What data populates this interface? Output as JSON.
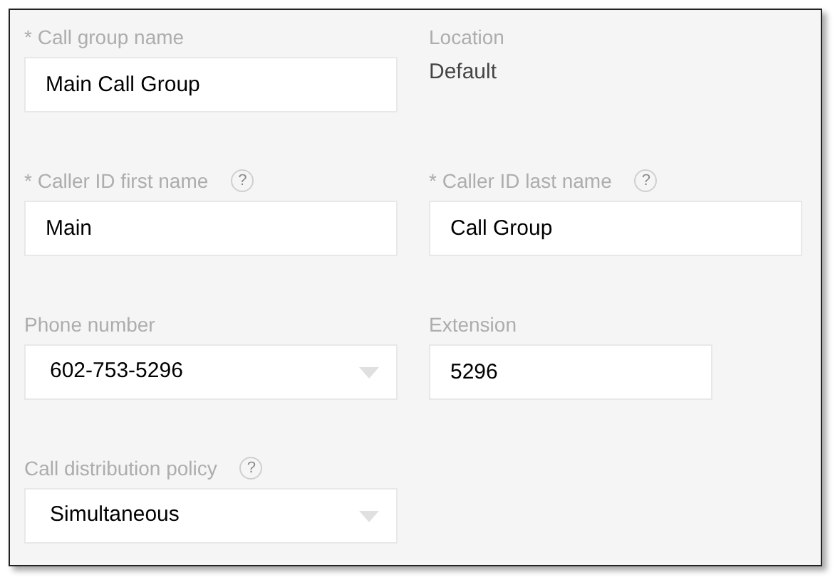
{
  "fields": [
    {
      "kind": "input",
      "label": "* Call group name",
      "value": "Main Call Group",
      "help": false,
      "short": false
    },
    {
      "kind": "static",
      "label": "Location",
      "value": "Default",
      "help": false,
      "short": false
    },
    {
      "kind": "input",
      "label": "* Caller ID first name",
      "value": "Main",
      "help": true,
      "short": false
    },
    {
      "kind": "input",
      "label": "* Caller ID last name",
      "value": "Call Group",
      "help": true,
      "short": false
    },
    {
      "kind": "select",
      "label": "Phone number",
      "value": "602-753-5296",
      "help": false,
      "short": false
    },
    {
      "kind": "input",
      "label": "Extension",
      "value": "5296",
      "help": false,
      "short": true
    },
    {
      "kind": "select",
      "label": "Call distribution policy",
      "value": "Simultaneous",
      "help": true,
      "short": false
    }
  ],
  "help_glyph": "?"
}
